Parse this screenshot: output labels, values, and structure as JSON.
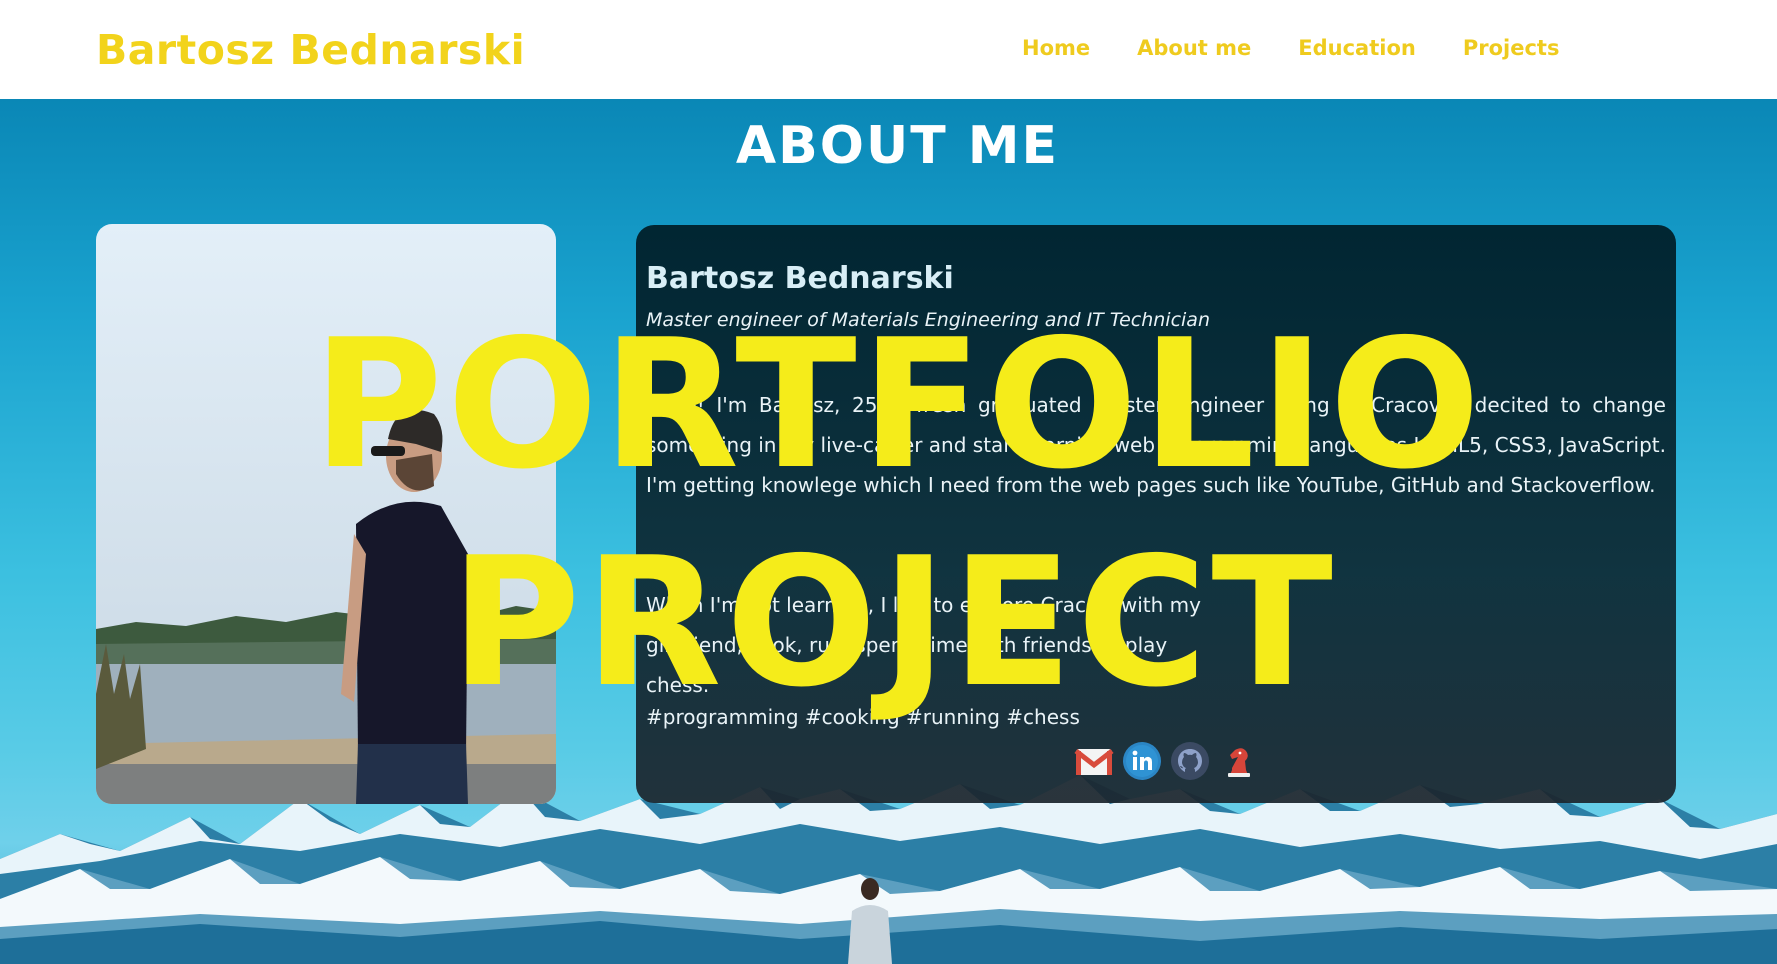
{
  "navbar": {
    "brand": "Bartosz Bednarski",
    "links": [
      "Home",
      "About me",
      "Education",
      "Projects"
    ]
  },
  "about": {
    "section_title": "ABOUT ME",
    "name": "Bartosz Bednarski",
    "subtitle": "Master engineer of Materials Engineering and IT Technician",
    "paragraph1": "Hello! I'm Bartosz, 25 y. fresh graduated master engineer living in Cracov. I decited to change something in my live-carrer and start learning web programming languages HTML5, CSS3, JavaScript. I'm getting knowlege which I need from the web pages such like YouTube, GitHub and Stackoverflow.",
    "paragraph2": "When I'm not learning, I like to explore Cracow with my girlfriend, cook, run, spend time with friends or play chess.",
    "tags": "#programming #cooking #running #chess",
    "social": [
      "gmail-icon",
      "linkedin-icon",
      "github-icon",
      "chess-knight-icon"
    ]
  },
  "overlay": {
    "line1": "PORTFOLIO",
    "line2": "PROJECT"
  },
  "colors": {
    "accent_yellow": "#f2d31b",
    "overlay_yellow": "#f5ec1a",
    "card_dark": "#00212c"
  }
}
